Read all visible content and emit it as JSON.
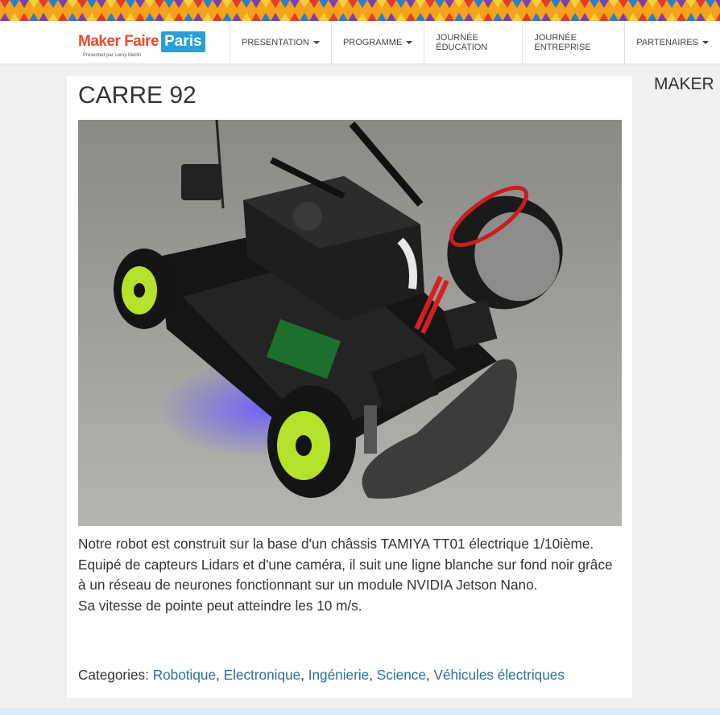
{
  "brand": {
    "logo_text_1": "Maker Faire",
    "logo_text_2": "Paris",
    "logo_subtitle": "Presented par Leroy Merlin"
  },
  "nav": {
    "items": [
      {
        "label": "PRESENTATION",
        "has_dropdown": true
      },
      {
        "label": "PROGRAMME",
        "has_dropdown": true
      },
      {
        "label": "JOURNÉE ÉDUCATION",
        "has_dropdown": false
      },
      {
        "label": "JOURNÉE ENTREPRISE",
        "has_dropdown": false
      },
      {
        "label": "PARTENAIRES",
        "has_dropdown": true
      }
    ]
  },
  "project": {
    "title": "CARRE 92",
    "image_alt": "robot car",
    "description_1": "Notre robot est construit sur la base d'un châssis TAMIYA TT01 électrique 1/10ième. Equipé de capteurs Lidars et d'une caméra, il suit une ligne blanche sur fond noir grâce à un réseau de neurones fonctionnant sur un module NVIDIA Jetson Nano.",
    "description_2": "Sa vitesse de pointe peut atteindre les 10 m/s.",
    "categories_label": "Categories:",
    "categories": [
      "Robotique",
      "Electronique",
      "Ingénierie",
      "Science",
      "Véhicules électriques"
    ]
  },
  "sidebar": {
    "heading": "MAKER"
  },
  "colors": {
    "banner": "#f4a21b",
    "link": "#2b6f98",
    "logo_red": "#e84b2f",
    "logo_blue": "#2a9fd6"
  }
}
